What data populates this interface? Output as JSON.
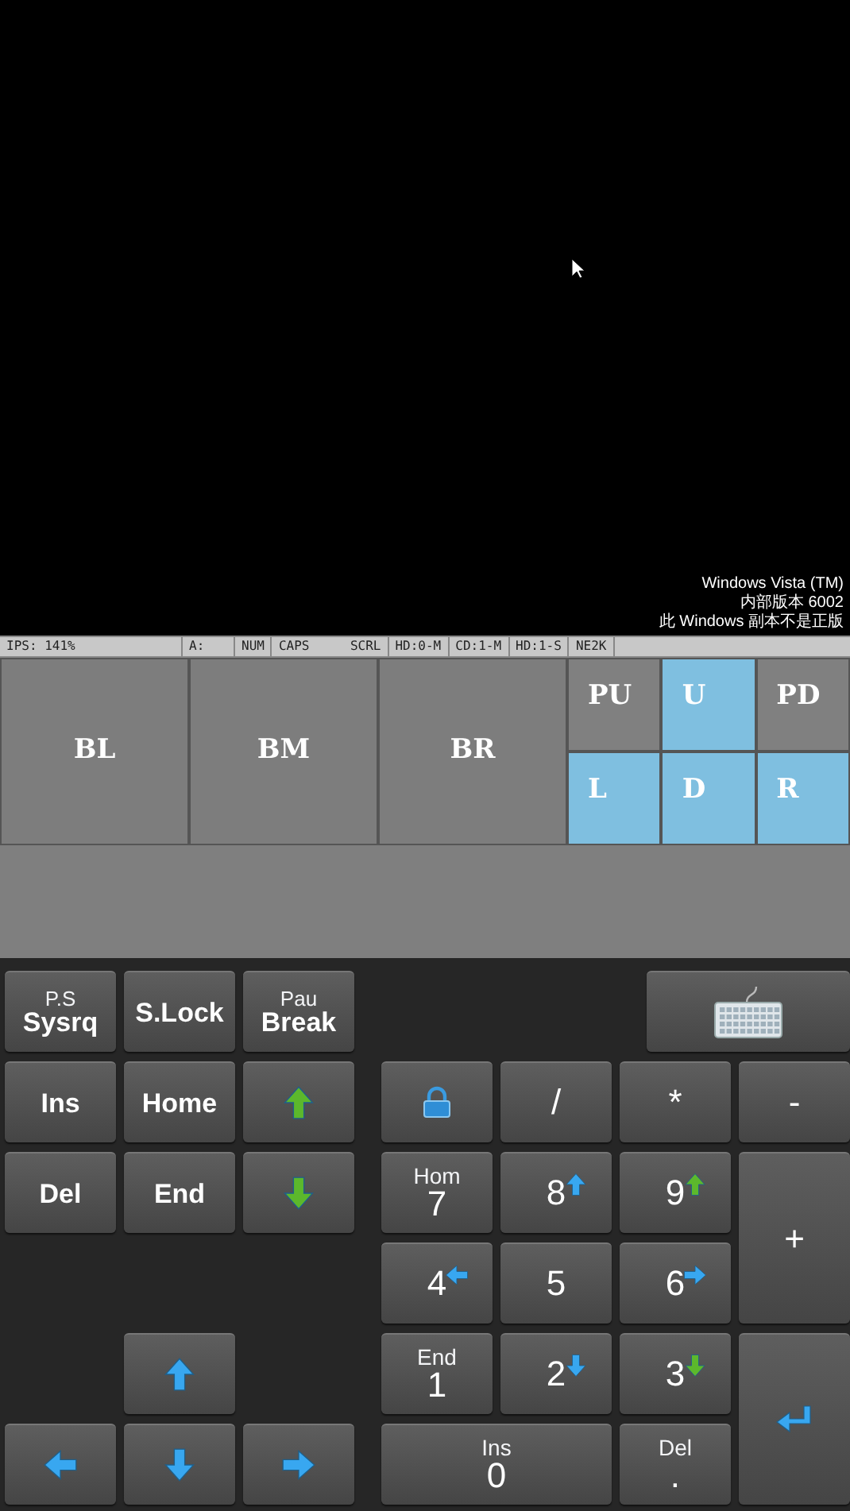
{
  "screen": {
    "version_lines": [
      "Windows Vista (TM)",
      "内部版本 6002",
      "此 Windows 副本不是正版"
    ]
  },
  "status_bar": {
    "cells": [
      "IPS: 141%",
      "A:",
      "NUM",
      "CAPS",
      "SCRL",
      "HD:0-M",
      "CD:1-M",
      "HD:1-S",
      "NE2K"
    ]
  },
  "mouse_buttons": [
    "BL",
    "BM",
    "BR"
  ],
  "direction_keys": [
    {
      "label": "PU",
      "color": "#808080"
    },
    {
      "label": "U",
      "color": "#7fbfe0"
    },
    {
      "label": "PD",
      "color": "#808080"
    },
    {
      "label": "L",
      "color": "#7fbfe0"
    },
    {
      "label": "D",
      "color": "#7fbfe0"
    },
    {
      "label": "R",
      "color": "#7fbfe0"
    }
  ],
  "keys": [
    {
      "kind": "text",
      "top": "P.S",
      "main": "Sysrq"
    },
    {
      "kind": "text",
      "main": "S.Lock"
    },
    {
      "kind": "text",
      "top": "Pau",
      "main": "Break"
    },
    {
      "kind": "keyboard"
    },
    {
      "kind": "text",
      "main": "Ins"
    },
    {
      "kind": "text",
      "main": "Home"
    },
    {
      "kind": "greenup"
    },
    {
      "kind": "lock"
    },
    {
      "kind": "num",
      "main": "/"
    },
    {
      "kind": "num",
      "main": "*"
    },
    {
      "kind": "num",
      "main": "-"
    },
    {
      "kind": "text",
      "main": "Del"
    },
    {
      "kind": "text",
      "main": "End"
    },
    {
      "kind": "greendown"
    },
    {
      "kind": "num",
      "top": "Hom",
      "main": "7"
    },
    {
      "kind": "numblueup",
      "main": "8"
    },
    {
      "kind": "numgreenup",
      "main": "9"
    },
    {
      "kind": "num",
      "main": "+"
    },
    {
      "kind": "numblueleft",
      "main": "4"
    },
    {
      "kind": "num",
      "main": "5"
    },
    {
      "kind": "numblueright",
      "main": "6"
    },
    {
      "kind": "up"
    },
    {
      "kind": "num",
      "top": "End",
      "main": "1"
    },
    {
      "kind": "numbluedown",
      "main": "2"
    },
    {
      "kind": "numgreendown",
      "main": "3"
    },
    {
      "kind": "enter"
    },
    {
      "kind": "left"
    },
    {
      "kind": "down"
    },
    {
      "kind": "right"
    },
    {
      "kind": "num",
      "top": "Ins",
      "main": "0"
    },
    {
      "kind": "num",
      "top": "Del",
      "main": "."
    }
  ]
}
